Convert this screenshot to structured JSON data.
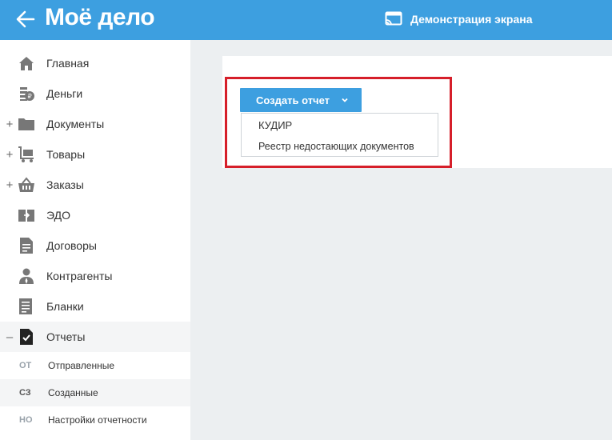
{
  "header": {
    "back_icon": "arrow-left-icon",
    "logo": "Моё дело",
    "demo_icon": "screen-cast-icon",
    "demo_label": "Демонстрация экрана",
    "bg_color": "#3d9fe0"
  },
  "sidebar": {
    "items": [
      {
        "label": "Главная",
        "icon": "home-icon",
        "expandable": false
      },
      {
        "label": "Деньги",
        "icon": "coins-icon",
        "expandable": false
      },
      {
        "label": "Документы",
        "icon": "folder-icon",
        "expandable": true
      },
      {
        "label": "Товары",
        "icon": "cart-icon",
        "expandable": true
      },
      {
        "label": "Заказы",
        "icon": "basket-icon",
        "expandable": true
      },
      {
        "label": "ЭДО",
        "icon": "edo-icon",
        "expandable": false
      },
      {
        "label": "Договоры",
        "icon": "contract-icon",
        "expandable": false
      },
      {
        "label": "Контрагенты",
        "icon": "person-icon",
        "expandable": false
      },
      {
        "label": "Бланки",
        "icon": "form-icon",
        "expandable": false
      },
      {
        "label": "Отчеты",
        "icon": "report-check-icon",
        "expandable": true,
        "expanded": true,
        "active": true
      }
    ],
    "expand_symbol": "+",
    "collapse_symbol": "–",
    "subitems": [
      {
        "code": "ОТ",
        "label": "Отправленные"
      },
      {
        "code": "СЗ",
        "label": "Созданные",
        "active": true
      },
      {
        "code": "НО",
        "label": "Настройки отчетности"
      }
    ]
  },
  "main": {
    "create_button_label": "Создать отчет",
    "dropdown_items": [
      "КУДИР",
      "Реестр недостающих документов"
    ],
    "highlight_color": "#d61f2a"
  }
}
